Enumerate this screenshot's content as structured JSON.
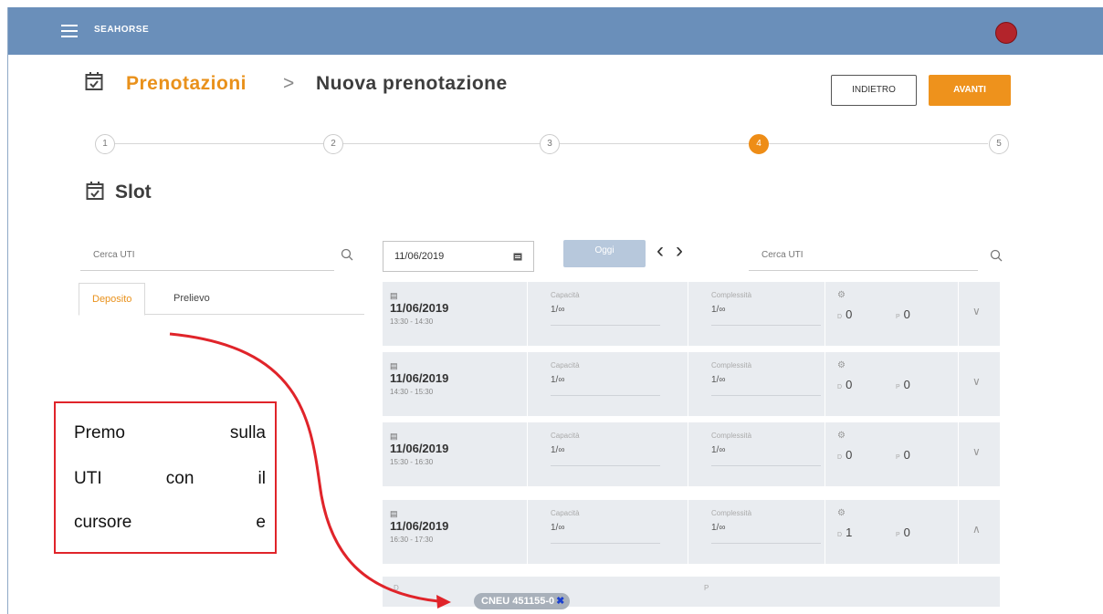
{
  "app": {
    "name": "SEAHORSE"
  },
  "header": {
    "breadcrumb_parent": "Prenotazioni",
    "breadcrumb_sep": ">",
    "breadcrumb_current": "Nuova prenotazione",
    "back_label": "INDIETRO",
    "next_label": "AVANTI"
  },
  "stepper": {
    "steps": [
      "1",
      "2",
      "3",
      "4",
      "5"
    ],
    "active_step": 4
  },
  "section": {
    "title": "Slot"
  },
  "left_panel": {
    "search_placeholder": "Cerca UTI",
    "tabs": [
      "Deposito",
      "Prelievo"
    ],
    "active_tab": "Deposito"
  },
  "toolbar": {
    "date": "11/06/2019",
    "today_label": "Oggi",
    "search_placeholder": "Cerca UTI"
  },
  "slots": [
    {
      "date": "11/06/2019",
      "time": "13:30 - 14:30",
      "cap_label": "Capacità",
      "cap_val": "1/∞",
      "compl_label": "Complessità",
      "compl_val": "1/∞",
      "count_a": "0",
      "count_b": "0"
    },
    {
      "date": "11/06/2019",
      "time": "14:30 - 15:30",
      "cap_label": "Capacità",
      "cap_val": "1/∞",
      "compl_label": "Complessità",
      "compl_val": "1/∞",
      "count_a": "0",
      "count_b": "0"
    },
    {
      "date": "11/06/2019",
      "time": "15:30 - 16:30",
      "cap_label": "Capacità",
      "cap_val": "1/∞",
      "compl_label": "Complessità",
      "compl_val": "1/∞",
      "count_a": "0",
      "count_b": "0"
    },
    {
      "date": "11/06/2019",
      "time": "16:30 - 17:30",
      "cap_label": "Capacità",
      "cap_val": "1/∞",
      "compl_label": "Complessità",
      "compl_val": "1/∞",
      "count_a": "1",
      "count_b": "0"
    }
  ],
  "expanded": {
    "col_a": "D",
    "col_b": "P",
    "chip_label": "CNEU 451155-0"
  },
  "note": {
    "lines": [
      [
        "Premo",
        "sulla"
      ],
      [
        "UTI",
        "con",
        "il"
      ],
      [
        "cursore",
        "e"
      ]
    ]
  },
  "colors": {
    "topbar": "#6a8fba",
    "accent": "#ee921c",
    "note_border": "#e0242a"
  }
}
